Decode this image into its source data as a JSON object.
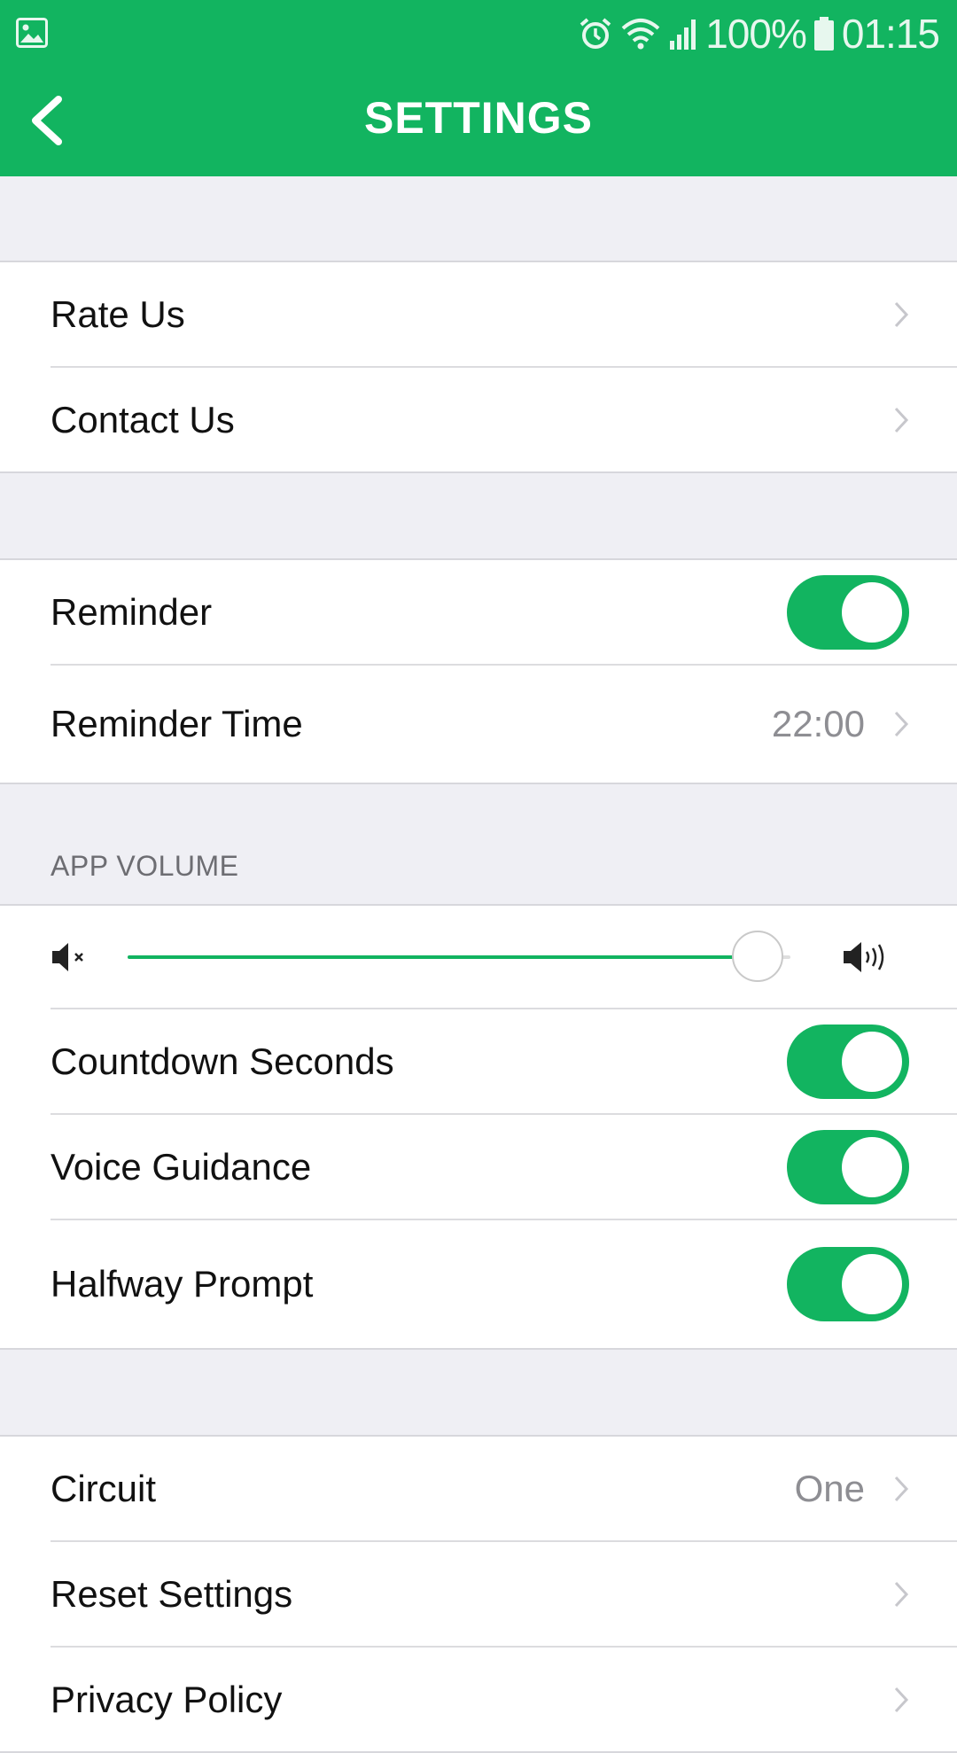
{
  "statusbar": {
    "battery_text": "100%",
    "time": "01:15"
  },
  "header": {
    "title": "SETTINGS"
  },
  "groups": {
    "feedback": {
      "rate_us": "Rate Us",
      "contact_us": "Contact Us"
    },
    "reminder": {
      "reminder_label": "Reminder",
      "reminder_on": true,
      "reminder_time_label": "Reminder Time",
      "reminder_time_value": "22:00"
    },
    "audio": {
      "section_title": "APP VOLUME",
      "volume_fraction": 0.95,
      "countdown_label": "Countdown Seconds",
      "countdown_on": true,
      "voice_label": "Voice Guidance",
      "voice_on": true,
      "halfway_label": "Halfway Prompt",
      "halfway_on": true
    },
    "workout": {
      "circuit_label": "Circuit",
      "circuit_value": "One",
      "reset_label": "Reset Settings",
      "privacy_label": "Privacy Policy"
    }
  },
  "colors": {
    "accent": "#12b460",
    "background": "#efeff4",
    "secondary_text": "#8e8e93"
  },
  "icons": {
    "back": "chevron-left-icon",
    "disclosure": "chevron-right-icon",
    "mute": "volume-mute-icon",
    "loud": "volume-up-icon"
  }
}
